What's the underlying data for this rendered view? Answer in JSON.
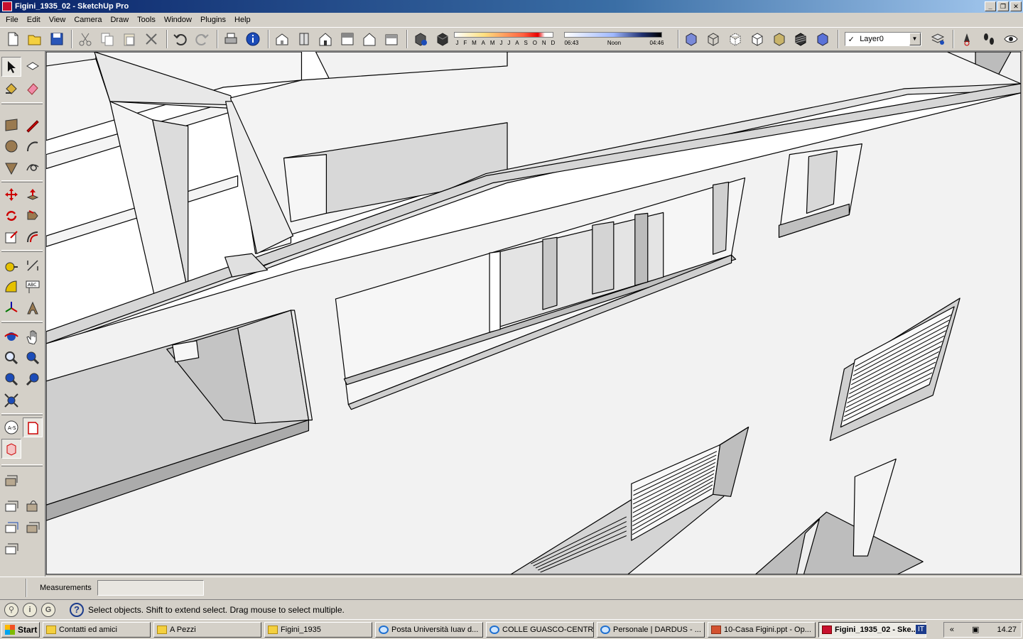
{
  "window": {
    "title": "Figini_1935_02 - SketchUp Pro",
    "buttons": [
      "_",
      "❐",
      "✕"
    ]
  },
  "menu": [
    "File",
    "Edit",
    "View",
    "Camera",
    "Draw",
    "Tools",
    "Window",
    "Plugins",
    "Help"
  ],
  "shadows": {
    "months": [
      "J",
      "F",
      "M",
      "A",
      "M",
      "J",
      "J",
      "A",
      "S",
      "O",
      "N",
      "D"
    ],
    "time_start": "06:43",
    "time_mid": "Noon",
    "time_end": "04:46"
  },
  "layer": {
    "current": "Layer0"
  },
  "measurements": {
    "label": "Measurements",
    "value": ""
  },
  "status": {
    "text": "Select objects. Shift to extend select. Drag mouse to select multiple.",
    "help_glyph": "?"
  },
  "taskbar": {
    "start": "Start",
    "tasks": [
      {
        "label": "Contatti ed amici",
        "icon": "folder-icon",
        "active": false
      },
      {
        "label": "A Pezzi",
        "icon": "folder-icon",
        "active": false
      },
      {
        "label": "Figini_1935",
        "icon": "folder-icon",
        "active": false
      },
      {
        "label": "Posta Università Iuav d...",
        "icon": "browser-icon",
        "active": false
      },
      {
        "label": "COLLE GUASCO-CENTR...",
        "icon": "browser-icon",
        "active": false
      },
      {
        "label": "Personale | DARDUS - ...",
        "icon": "browser-icon",
        "active": false
      },
      {
        "label": "10-Casa Figini.ppt - Op...",
        "icon": "presentation-icon",
        "active": false
      },
      {
        "label": "Figini_1935_02 - Ske...",
        "icon": "sketchup-icon",
        "active": true
      }
    ],
    "language": "IT",
    "tray_arrow": "«",
    "clock": "14.27"
  },
  "colors": {
    "title_bar": "#0a246a",
    "face_light": "#f2f2f2",
    "face_mid": "#d6d6d6",
    "face_dark": "#bdbdbd",
    "edge": "#000000"
  }
}
